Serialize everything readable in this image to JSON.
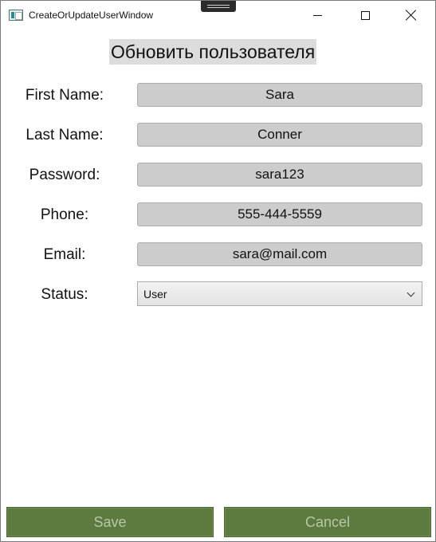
{
  "window": {
    "title": "CreateOrUpdateUserWindow"
  },
  "form": {
    "heading": "Обновить пользователя",
    "fields": [
      {
        "label": "First Name:",
        "value": "Sara"
      },
      {
        "label": "Last Name:",
        "value": "Conner"
      },
      {
        "label": "Password:",
        "value": "sara123"
      },
      {
        "label": "Phone:",
        "value": "555-444-5559"
      },
      {
        "label": "Email:",
        "value": "sara@mail.com"
      }
    ],
    "status": {
      "label": "Status:",
      "selected": "User"
    }
  },
  "actions": {
    "save_label": "Save",
    "cancel_label": "Cancel"
  },
  "colors": {
    "button_bg": "#5d7a3f",
    "button_text": "#b9c6a8",
    "field_bg": "#cccccc",
    "heading_bg": "#dcdcdc"
  },
  "icons": {
    "app": "app-window-icon",
    "minimize": "minimize-icon",
    "maximize": "maximize-icon",
    "close": "close-icon",
    "dropdown": "chevron-down-icon"
  }
}
